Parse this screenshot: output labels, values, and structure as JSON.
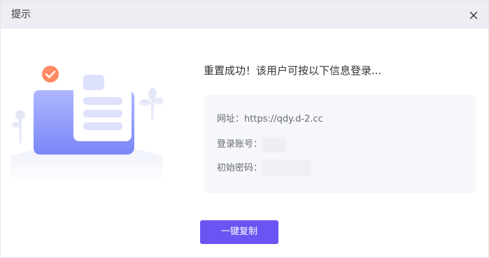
{
  "dialog": {
    "title": "提示",
    "close_icon": "close-icon",
    "message": "重置成功！该用户可按以下信息登录...",
    "info": {
      "url_label": "网址：",
      "url_value": "https://qdy.d-2.cc",
      "account_label": "登录账号：",
      "password_label": "初始密码："
    },
    "copy_button": "一键复制"
  },
  "colors": {
    "header_bg": "#eceef3",
    "primary": "#6b55f2",
    "panel_bg": "#f6f7fa",
    "check_badge": "#ff8a63"
  }
}
